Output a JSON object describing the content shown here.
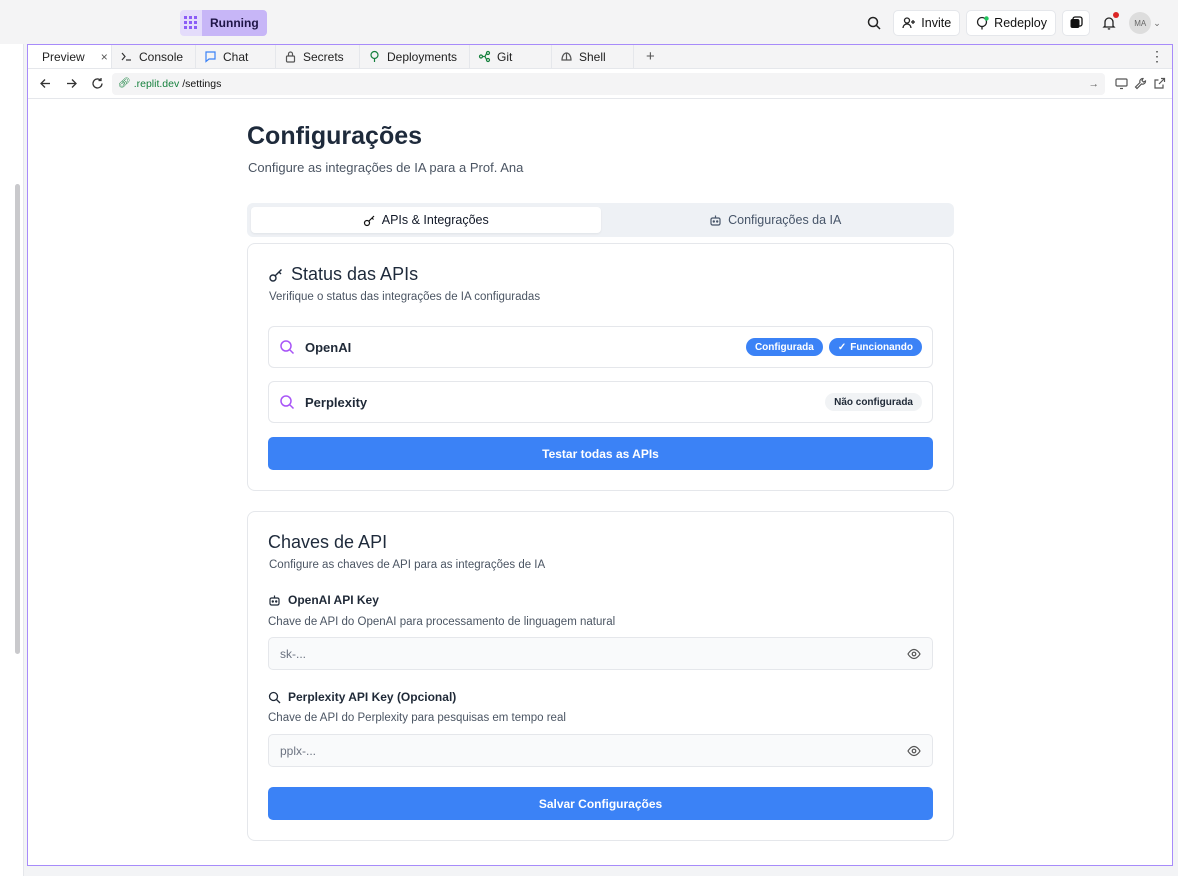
{
  "topbar": {
    "running_label": "Running",
    "invite_label": "Invite",
    "redeploy_label": "Redeploy",
    "avatar_initials": "MA"
  },
  "tabs": [
    {
      "label": "Preview",
      "icon": "monitor-icon",
      "active": true
    },
    {
      "label": "Console",
      "icon": "terminal-icon"
    },
    {
      "label": "Chat",
      "icon": "chat-icon"
    },
    {
      "label": "Secrets",
      "icon": "lock-icon"
    },
    {
      "label": "Deployments",
      "icon": "deployments-icon"
    },
    {
      "label": "Git",
      "icon": "git-icon"
    },
    {
      "label": "Shell",
      "icon": "shell-icon"
    }
  ],
  "url": {
    "domain": ".replit.dev",
    "path": "/settings"
  },
  "page": {
    "title": "Configurações",
    "subtitle": "Configure as integrações de IA para a Prof. Ana"
  },
  "segments": {
    "apis": "APIs & Integrações",
    "ai_config": "Configurações da IA"
  },
  "status_card": {
    "title": "Status das APIs",
    "description": "Verifique o status das integrações de IA configuradas",
    "rows": [
      {
        "name": "OpenAI",
        "badge1": "Configurada",
        "badge2": "Funcionando"
      },
      {
        "name": "Perplexity",
        "badge1": "Não configurada"
      }
    ],
    "test_button": "Testar todas as APIs"
  },
  "keys_card": {
    "title": "Chaves de API",
    "description": "Configure as chaves de API para as integrações de IA",
    "openai_label": "OpenAI API Key",
    "openai_help": "Chave de API do OpenAI para processamento de linguagem natural",
    "openai_placeholder": "sk-...",
    "perplexity_label": "Perplexity API Key (Opcional)",
    "perplexity_help": "Chave de API do Perplexity para pesquisas em tempo real",
    "perplexity_placeholder": "pplx-...",
    "save_button": "Salvar Configurações"
  },
  "colors": {
    "accent": "#3b82f6",
    "running_bg": "#c7b6f7",
    "panel_border": "#a78bfa",
    "icon_purple": "#a855f7"
  }
}
